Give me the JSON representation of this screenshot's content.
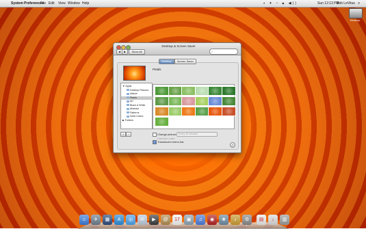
{
  "menubar": {
    "apple": "",
    "app_name": "System Preferences",
    "items": [
      "File",
      "Edit",
      "View",
      "Window",
      "Help"
    ],
    "status_icons": "◐ ✦ ◔ ▲ ◀))",
    "clock": "Sun 12:13 PM",
    "user": "Bob LeVitus",
    "spotlight": "⌕"
  },
  "desktop": {
    "disk_label": "Desktop"
  },
  "window": {
    "title": "Desktop & Screen Saver",
    "back": "◀",
    "forward": "▶",
    "show_all": "Show All",
    "search_placeholder": "",
    "tabs": [
      {
        "label": "Desktop",
        "active": true
      },
      {
        "label": "Screen Saver",
        "active": false
      }
    ],
    "selected_picture": "Petals",
    "sources": [
      {
        "label": "▼ Apple",
        "type": "group"
      },
      {
        "label": "Desktop Pictures",
        "type": "item"
      },
      {
        "label": "Nature",
        "type": "item"
      },
      {
        "label": "Plants",
        "type": "item",
        "selected": true
      },
      {
        "label": "Art",
        "type": "item"
      },
      {
        "label": "Black & White",
        "type": "item"
      },
      {
        "label": "Abstract",
        "type": "item"
      },
      {
        "label": "Patterns",
        "type": "item"
      },
      {
        "label": "Solid Colors",
        "type": "item"
      },
      {
        "label": "▶ Folders",
        "type": "group"
      }
    ],
    "thumbnails": [
      {
        "name": "leaf-1",
        "color": "#4f9a3a"
      },
      {
        "name": "bamboo",
        "color": "#6aa24a"
      },
      {
        "name": "grass",
        "color": "#8cc064"
      },
      {
        "name": "dandelion",
        "color": "#b9ddb0"
      },
      {
        "name": "fern",
        "color": "#3d8a3a"
      },
      {
        "name": "leaf-2",
        "color": "#2f7a2f"
      },
      {
        "name": "water-drops",
        "color": "#5f9a4a"
      },
      {
        "name": "plant-green",
        "color": "#7ab85a"
      },
      {
        "name": "lotus-pink",
        "color": "#d89aa0"
      },
      {
        "name": "lime",
        "color": "#a8d060"
      },
      {
        "name": "blue-flower",
        "color": "#6c8cd8"
      },
      {
        "name": "bokeh-green",
        "color": "#4a8a3a"
      },
      {
        "name": "orange-leaf",
        "color": "#d98a2a"
      },
      {
        "name": "sprout",
        "color": "#9ccc6a"
      },
      {
        "name": "rose-orange",
        "color": "#ee7a1a"
      },
      {
        "name": "green-drops",
        "color": "#5aa04a"
      },
      {
        "name": "petals",
        "color": "#e85a10"
      },
      {
        "name": "leaves-red",
        "color": "#c8502a"
      },
      {
        "name": "shoot",
        "color": "#68b040"
      }
    ],
    "add": "+",
    "remove": "−",
    "change_picture_label": "Change picture:",
    "change_picture_checked": false,
    "interval_value": "Every 30 minutes",
    "random_order_label": "Random order",
    "translucent_label": "Translucent menu bar",
    "translucent_checked": true,
    "help": "?"
  },
  "dock": {
    "items": [
      {
        "name": "finder",
        "color": "#3b7bd6",
        "glyph": "☺"
      },
      {
        "name": "launchpad",
        "color": "#6c7c8c",
        "glyph": "✈"
      },
      {
        "name": "mission-control",
        "color": "#2a4a7a",
        "glyph": "▦"
      },
      {
        "name": "app-store",
        "color": "#2a8ad8",
        "glyph": "A"
      },
      {
        "name": "safari",
        "color": "#4aa0e8",
        "glyph": "◎"
      },
      {
        "name": "mail",
        "color": "#b8c8d8",
        "glyph": "✉"
      },
      {
        "name": "facetime",
        "color": "#3a3a3a",
        "glyph": "▶"
      },
      {
        "name": "contacts",
        "color": "#b08a50",
        "glyph": "@"
      },
      {
        "name": "calendar",
        "color": "#f2f2f2",
        "glyph": "17"
      },
      {
        "name": "preview",
        "color": "#8aa0b0",
        "glyph": "▣"
      },
      {
        "name": "itunes",
        "color": "#4a7ad8",
        "glyph": "♫"
      },
      {
        "name": "photo-booth",
        "color": "#b02020",
        "glyph": "◉"
      },
      {
        "name": "iphoto",
        "color": "#6a8aa0",
        "glyph": "❀"
      },
      {
        "name": "garageband",
        "color": "#c89a30",
        "glyph": "♪"
      },
      {
        "name": "system-preferences",
        "color": "#888888",
        "glyph": "⚙"
      },
      {
        "name": "documents",
        "color": "#e8e8e8",
        "glyph": "▤"
      },
      {
        "name": "downloads",
        "color": "#d8d8d8",
        "glyph": "↓"
      },
      {
        "name": "trash",
        "color": "#9a9a9a",
        "glyph": "▥"
      }
    ]
  }
}
